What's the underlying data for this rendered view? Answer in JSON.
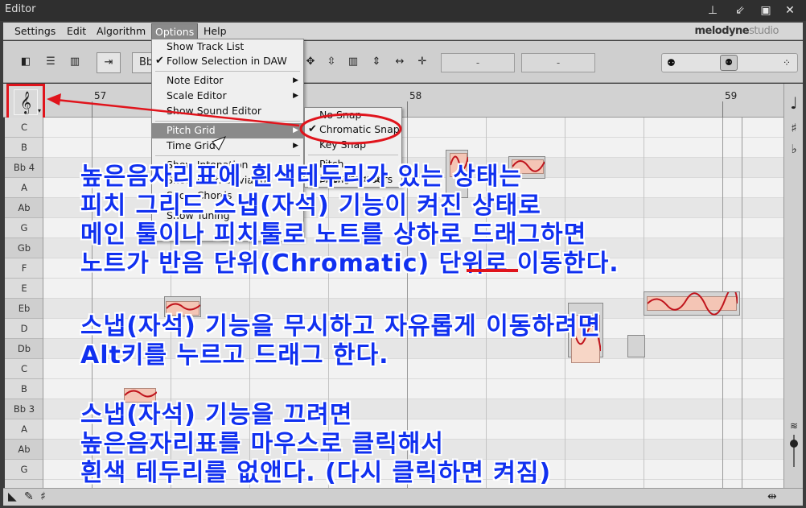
{
  "window": {
    "title": "Editor"
  },
  "menubar": {
    "items": [
      "Settings",
      "Edit",
      "Algorithm",
      "Options",
      "Help"
    ],
    "brand_main": "melodyne",
    "brand_sub": "studio"
  },
  "toolbar": {
    "key_field": "Bb",
    "field1": "-",
    "field2": "-"
  },
  "ruler": {
    "bars": [
      "57",
      "58",
      "59"
    ]
  },
  "keys": [
    "C",
    "B",
    "Bb 4",
    "A",
    "Ab",
    "G",
    "Gb",
    "F",
    "E",
    "Eb",
    "D",
    "Db",
    "C",
    "B",
    "Bb 3",
    "A",
    "Ab",
    "G"
  ],
  "options_menu": {
    "items": [
      {
        "label": "Show Track List",
        "checked": false,
        "submenu": false
      },
      {
        "label": "Follow Selection in DAW",
        "checked": true,
        "submenu": false
      },
      {
        "label": "Note Editor",
        "checked": false,
        "submenu": true
      },
      {
        "label": "Scale Editor",
        "checked": false,
        "submenu": true
      },
      {
        "label": "Show Sound Editor",
        "checked": false,
        "submenu": false
      },
      {
        "label": "Pitch Grid",
        "checked": false,
        "submenu": true
      },
      {
        "label": "Time Grid",
        "checked": false,
        "submenu": true
      },
      {
        "label": "Show Intonation",
        "checked": false,
        "submenu": false
      },
      {
        "label": "Show Pitch Deviation",
        "checked": false,
        "submenu": false
      },
      {
        "label": "Show Chords",
        "checked": false,
        "submenu": false
      },
      {
        "label": "Show Tuning",
        "checked": false,
        "submenu": false
      }
    ]
  },
  "pitch_grid_menu": {
    "items": [
      {
        "label": "No Snap",
        "checked": false
      },
      {
        "label": "Chromatic Snap",
        "checked": true
      },
      {
        "label": "Key Snap",
        "checked": false
      },
      {
        "label": "Pitch Background",
        "checked": false
      },
      {
        "label": "Pitch Numbers",
        "checked": false
      }
    ]
  },
  "annotation": {
    "lines": [
      "높은음자리표에 흰색테두리가 있는 상태는",
      "피치 그리드 스냅(자석) 기능이 켜진 상태로",
      "메인 툴이나 피치툴로 노트를 상하로 드래그하면",
      "노트가 반음 단위(Chromatic) 단위로 이동한다.",
      "스냅(자석) 기능을 무시하고 자유롭게 이동하려면",
      "Alt키를 누르고 드래그 한다.",
      "스냅(자석) 기능을 끄려면",
      "높은음자리표를 마우스로 클릭해서",
      "흰색 테두리를 없앤다. (다시 클릭하면 켜짐)"
    ]
  },
  "colors": {
    "annotation_text": "#1030f0",
    "annotation_highlight": "#e0141c",
    "menu_highlight": "#8a8a8a"
  },
  "icons": {
    "clef": "treble-clef-icon",
    "pin": "pin-icon",
    "minimize": "minimize-icon",
    "maximize": "maximize-icon",
    "close": "close-icon"
  }
}
